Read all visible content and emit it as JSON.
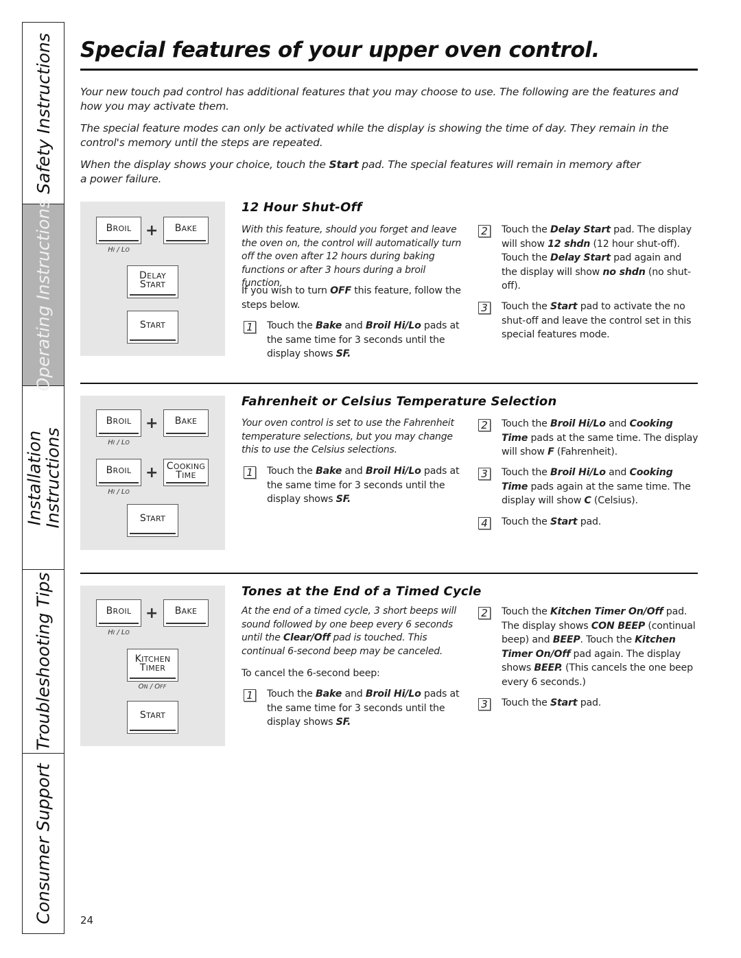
{
  "side_tabs": [
    {
      "label": "Safety Instructions",
      "active": false
    },
    {
      "label": "Operating Instructions",
      "active": true
    },
    {
      "label": "Installation\nInstructions",
      "line1": "Installation",
      "line2": "Instructions",
      "active": false
    },
    {
      "label": "Troubleshooting Tips",
      "active": false
    },
    {
      "label": "Consumer Support",
      "active": false
    }
  ],
  "title": "Special features of your upper oven control.",
  "intro": [
    "Your new touch pad control has additional features that you may choose to use. The following are the features and how you may activate them.",
    "The special feature modes can only be activated while the display is showing the time of day. They remain in the control's memory until the steps are repeated.",
    {
      "before": "When the display shows your choice, touch the ",
      "bold": "Start",
      "after": " pad. The special features will remain in memory after a power failure."
    }
  ],
  "pads": {
    "broil": "Broil",
    "bake": "Bake",
    "hi_lo": "Hi / Lo",
    "delay_start": [
      "Delay",
      "Start"
    ],
    "start": "Start",
    "cooking_time": [
      "Cooking",
      "Time"
    ],
    "kitchen_timer": [
      "Kitchen",
      "Timer"
    ],
    "on_off": "On / Off",
    "plus": "+"
  },
  "sections": [
    {
      "heading": "12 Hour Shut-Off",
      "description": "With this feature, should you forget and leave the oven on, the control will automatically turn off the oven after 12 hours during baking functions or after 3 hours during a broil function.",
      "note": {
        "before": "If you wish to turn ",
        "bold": "OFF",
        "after": " this feature, follow the steps below."
      },
      "steps": [
        {
          "num": "1",
          "html": "Touch the <b>Bake</b> and <b>Broil Hi/Lo</b> pads at the same time for 3 seconds until the display shows <b>SF.</b>"
        },
        {
          "num": "2",
          "html": "Touch the <b>Delay Start</b> pad. The display will show <b>12 shdn</b> (12 hour shut-off). Touch the <b>Delay Start</b> pad again and the display will show <b>no shdn</b> (no shut-off)."
        },
        {
          "num": "3",
          "html": "Touch the <b>Start</b> pad to activate the no shut-off and leave the control set in this special features mode."
        }
      ]
    },
    {
      "heading": "Fahrenheit or Celsius Temperature Selection",
      "description": "Your oven control is set to use the Fahrenheit temperature selections, but you may change this to use the Celsius selections.",
      "steps": [
        {
          "num": "1",
          "html": "Touch the <b>Bake</b> and <b>Broil Hi/Lo</b> pads at the same time for 3 seconds until the display shows <b>SF.</b>"
        },
        {
          "num": "2",
          "html": "Touch the <b>Broil Hi/Lo</b> and <b>Cooking Time</b> pads at the same time. The display will show <b>F</b> (Fahrenheit)."
        },
        {
          "num": "3",
          "html": "Touch the <b>Broil Hi/Lo</b> and <b>Cooking Time</b> pads again at the same time. The display will show <b>C</b> (Celsius)."
        },
        {
          "num": "4",
          "html": "Touch the <b>Start</b> pad."
        }
      ]
    },
    {
      "heading": "Tones at the End of a Timed Cycle",
      "description": "At the end of a timed cycle, 3 short beeps will sound followed by one beep every 6 seconds until the <b>Clear/Off</b> pad is touched. This continual 6-second beep may be canceled.",
      "note_plain": "To cancel the 6-second beep:",
      "steps": [
        {
          "num": "1",
          "html": "Touch the <b>Bake</b> and <b>Broil Hi/Lo</b> pads at the same time for 3 seconds until the display shows <b>SF.</b>"
        },
        {
          "num": "2",
          "html": "Touch the <b>Kitchen Timer On/Off</b> pad. The display shows <b>CON BEEP</b> (continual beep) and <b>BEEP</b>. Touch the <b>Kitchen Timer On/Off</b> pad again. The display shows <b>BEEP.</b> (This cancels the one beep every 6 seconds.)"
        },
        {
          "num": "3",
          "html": "Touch the <b>Start</b> pad."
        }
      ]
    }
  ],
  "page_number": "24"
}
